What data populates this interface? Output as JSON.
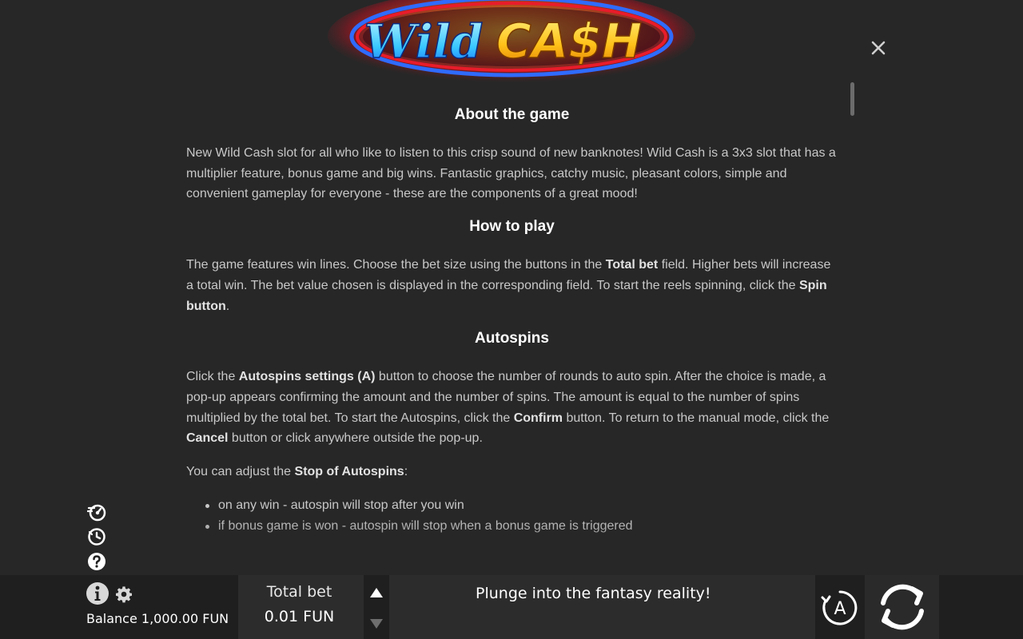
{
  "logo": {
    "word1": "Wild",
    "word2": "CA$H"
  },
  "content": {
    "sections": [
      {
        "heading": "About the game",
        "para1": "New Wild Cash slot for all who like to listen to this crisp sound of new banknotes! Wild Cash is a 3x3 slot that has a multiplier feature, bonus game and big wins. Fantastic graphics, catchy music, pleasant colors, simple and convenient gameplay for everyone - these are the components of a great mood!"
      },
      {
        "heading": "How to play",
        "p_a": "The game features win lines. Choose the bet size using the buttons in the ",
        "p_b": "Total bet",
        "p_c": " field. Higher bets will increase a total win. The bet value chosen is displayed in the corresponding field. To start the reels spinning, click the ",
        "p_d": "Spin button",
        "p_e": "."
      },
      {
        "heading": "Autospins",
        "p1_a": "Click the ",
        "p1_b": "Autospins settings (A)",
        "p1_c": " button to choose the number of rounds to auto spin. After the choice is made, a pop-up appears confirming the amount and the number of spins. The amount is equal to the number of spins multiplied by the total bet. To start the Autospins, click the ",
        "p1_d": "Confirm",
        "p1_e": " button. To return to the manual mode, click the ",
        "p1_f": "Cancel",
        "p1_g": " button or click anywhere outside the pop-up.",
        "p2_a": "You can adjust the ",
        "p2_b": "Stop of Autospins",
        "p2_c": ":",
        "bullets": [
          "on any win - autospin will stop after you win",
          "if bonus game is won - autospin will stop when a bonus game is triggered"
        ]
      }
    ]
  },
  "bottom_bar": {
    "balance": "Balance 1,000.00 FUN",
    "total_bet_label": "Total bet",
    "total_bet_value": "0.01 FUN",
    "message": "Plunge into the fantasy reality!",
    "auto_label": "A"
  },
  "icons": {
    "close": "close-icon",
    "turbo": "turbo-icon",
    "history": "history-icon",
    "help": "help-icon",
    "info": "info-icon",
    "settings": "gear-icon",
    "autospin": "autospin-icon",
    "spin": "spin-icon"
  },
  "colors": {
    "background": "#272727",
    "bar": "#1f1f1f",
    "heading": "#ffffff",
    "text": "#c8c8c8",
    "logo_blue": "#38c8ff",
    "logo_gold": "#ffc21a",
    "logo_green": "#20c020",
    "logo_red": "#e81c2a"
  }
}
